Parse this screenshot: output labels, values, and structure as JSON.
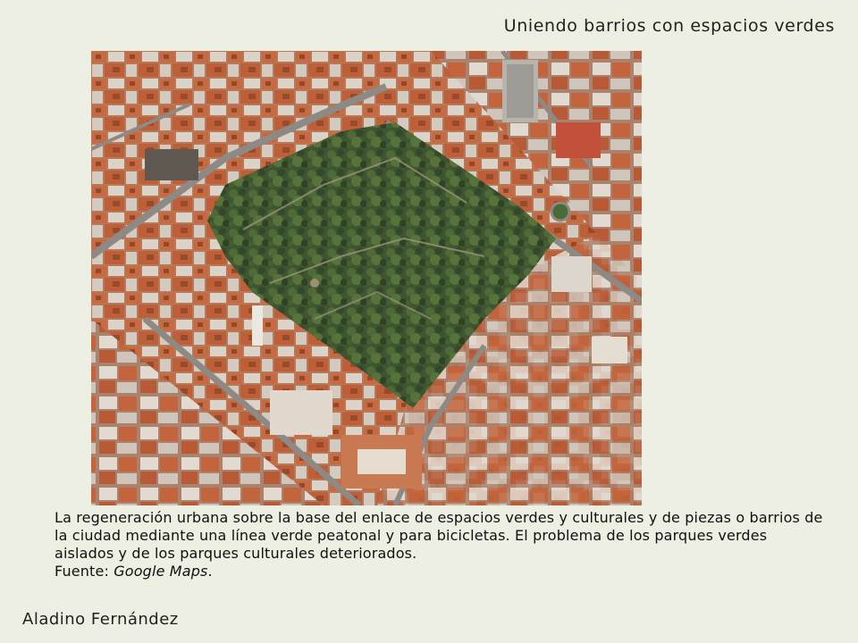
{
  "slide": {
    "title": "Uniendo barrios con espacios verdes",
    "caption": {
      "text": "La regeneración urbana sobre la base del enlace de espacios verdes y culturales y de piezas o barrios de la ciudad mediante una línea verde peatonal y para bicicletas. El problema de los parques verdes aislados y de los parques culturales deteriorados.",
      "source_label": "Fuente: ",
      "source_name": "Google Maps",
      "source_end": "."
    },
    "author": "Aladino Fernández"
  },
  "photo": {
    "subject": "aerial-view-city-park",
    "colors": {
      "roof_terracotta": "#c0673f",
      "roof_light": "#d9cfc4",
      "park_green": "#3f5a2c",
      "street_gray": "#8d8a86"
    }
  }
}
